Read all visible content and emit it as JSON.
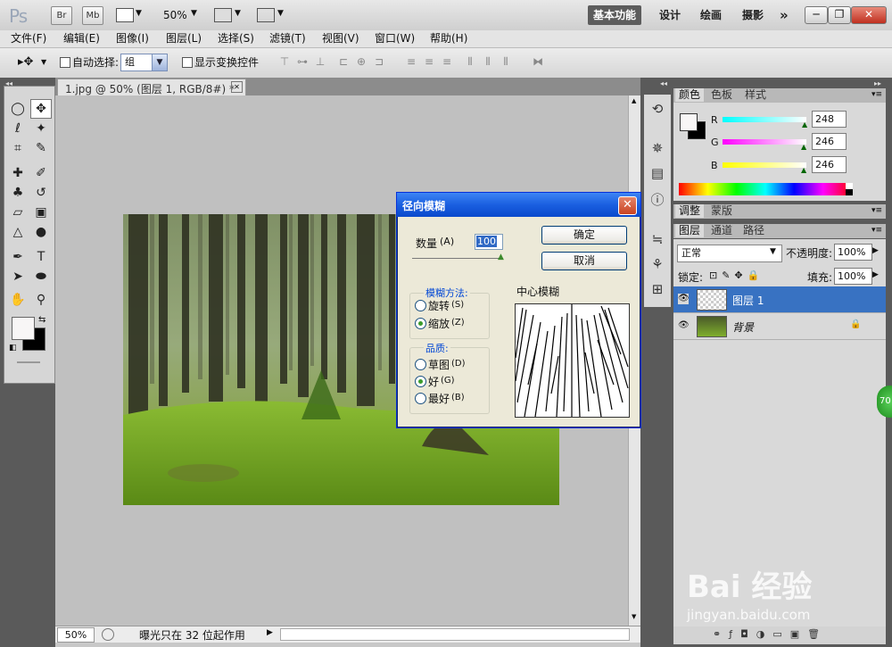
{
  "app": {
    "logo": "Ps",
    "bridge_btn": "Br",
    "minibridge_btn": "Mb",
    "zoom": "50%",
    "workspaces": [
      "基本功能",
      "设计",
      "绘画",
      "摄影"
    ],
    "more": "»",
    "window_controls": [
      "─",
      "❐",
      "✕"
    ]
  },
  "menu": [
    "文件(F)",
    "编辑(E)",
    "图像(I)",
    "图层(L)",
    "选择(S)",
    "滤镜(T)",
    "视图(V)",
    "窗口(W)",
    "帮助(H)"
  ],
  "options": {
    "auto_select_label": "自动选择:",
    "auto_select_value": "组",
    "show_transform_label": "显示变换控件"
  },
  "document": {
    "tab_title": "1.jpg @ 50% (图层 1, RGB/8#) *",
    "tab_close": "✕",
    "status_zoom": "50%",
    "status_text": "曝光只在 32 位起作用"
  },
  "color_panel": {
    "tabs": [
      "颜色",
      "色板",
      "样式"
    ],
    "channels": [
      {
        "label": "R",
        "value": "248",
        "color": "#00d8d8"
      },
      {
        "label": "G",
        "value": "246",
        "color": "#e020e0"
      },
      {
        "label": "B",
        "value": "246",
        "color": "#e0e020"
      }
    ]
  },
  "adjust_panel": {
    "tabs": [
      "调整",
      "蒙版"
    ]
  },
  "layers_panel": {
    "tabs": [
      "图层",
      "通道",
      "路径"
    ],
    "blend_mode": "正常",
    "opacity_label": "不透明度:",
    "opacity_value": "100%",
    "lock_label": "锁定:",
    "fill_label": "填充:",
    "fill_value": "100%",
    "layers": [
      {
        "name": "图层 1",
        "selected": true
      },
      {
        "name": "背景",
        "selected": false
      }
    ]
  },
  "dialog": {
    "title": "径向模糊",
    "amount_label": "数量",
    "amount_key": "(A)",
    "amount_value": "100",
    "ok_label": "确定",
    "cancel_label": "取消",
    "method_group": "模糊方法:",
    "methods": [
      {
        "label": "旋转",
        "key": "(S)",
        "checked": false
      },
      {
        "label": "缩放",
        "key": "(Z)",
        "checked": true
      }
    ],
    "quality_group": "品质:",
    "qualities": [
      {
        "label": "草图",
        "key": "(D)",
        "checked": false
      },
      {
        "label": "好",
        "key": "(G)",
        "checked": true
      },
      {
        "label": "最好",
        "key": "(B)",
        "checked": false
      }
    ],
    "center_label": "中心模糊"
  },
  "watermark": {
    "brand": "Bai 经验",
    "url": "jingyan.baidu.com",
    "badge": "70"
  }
}
